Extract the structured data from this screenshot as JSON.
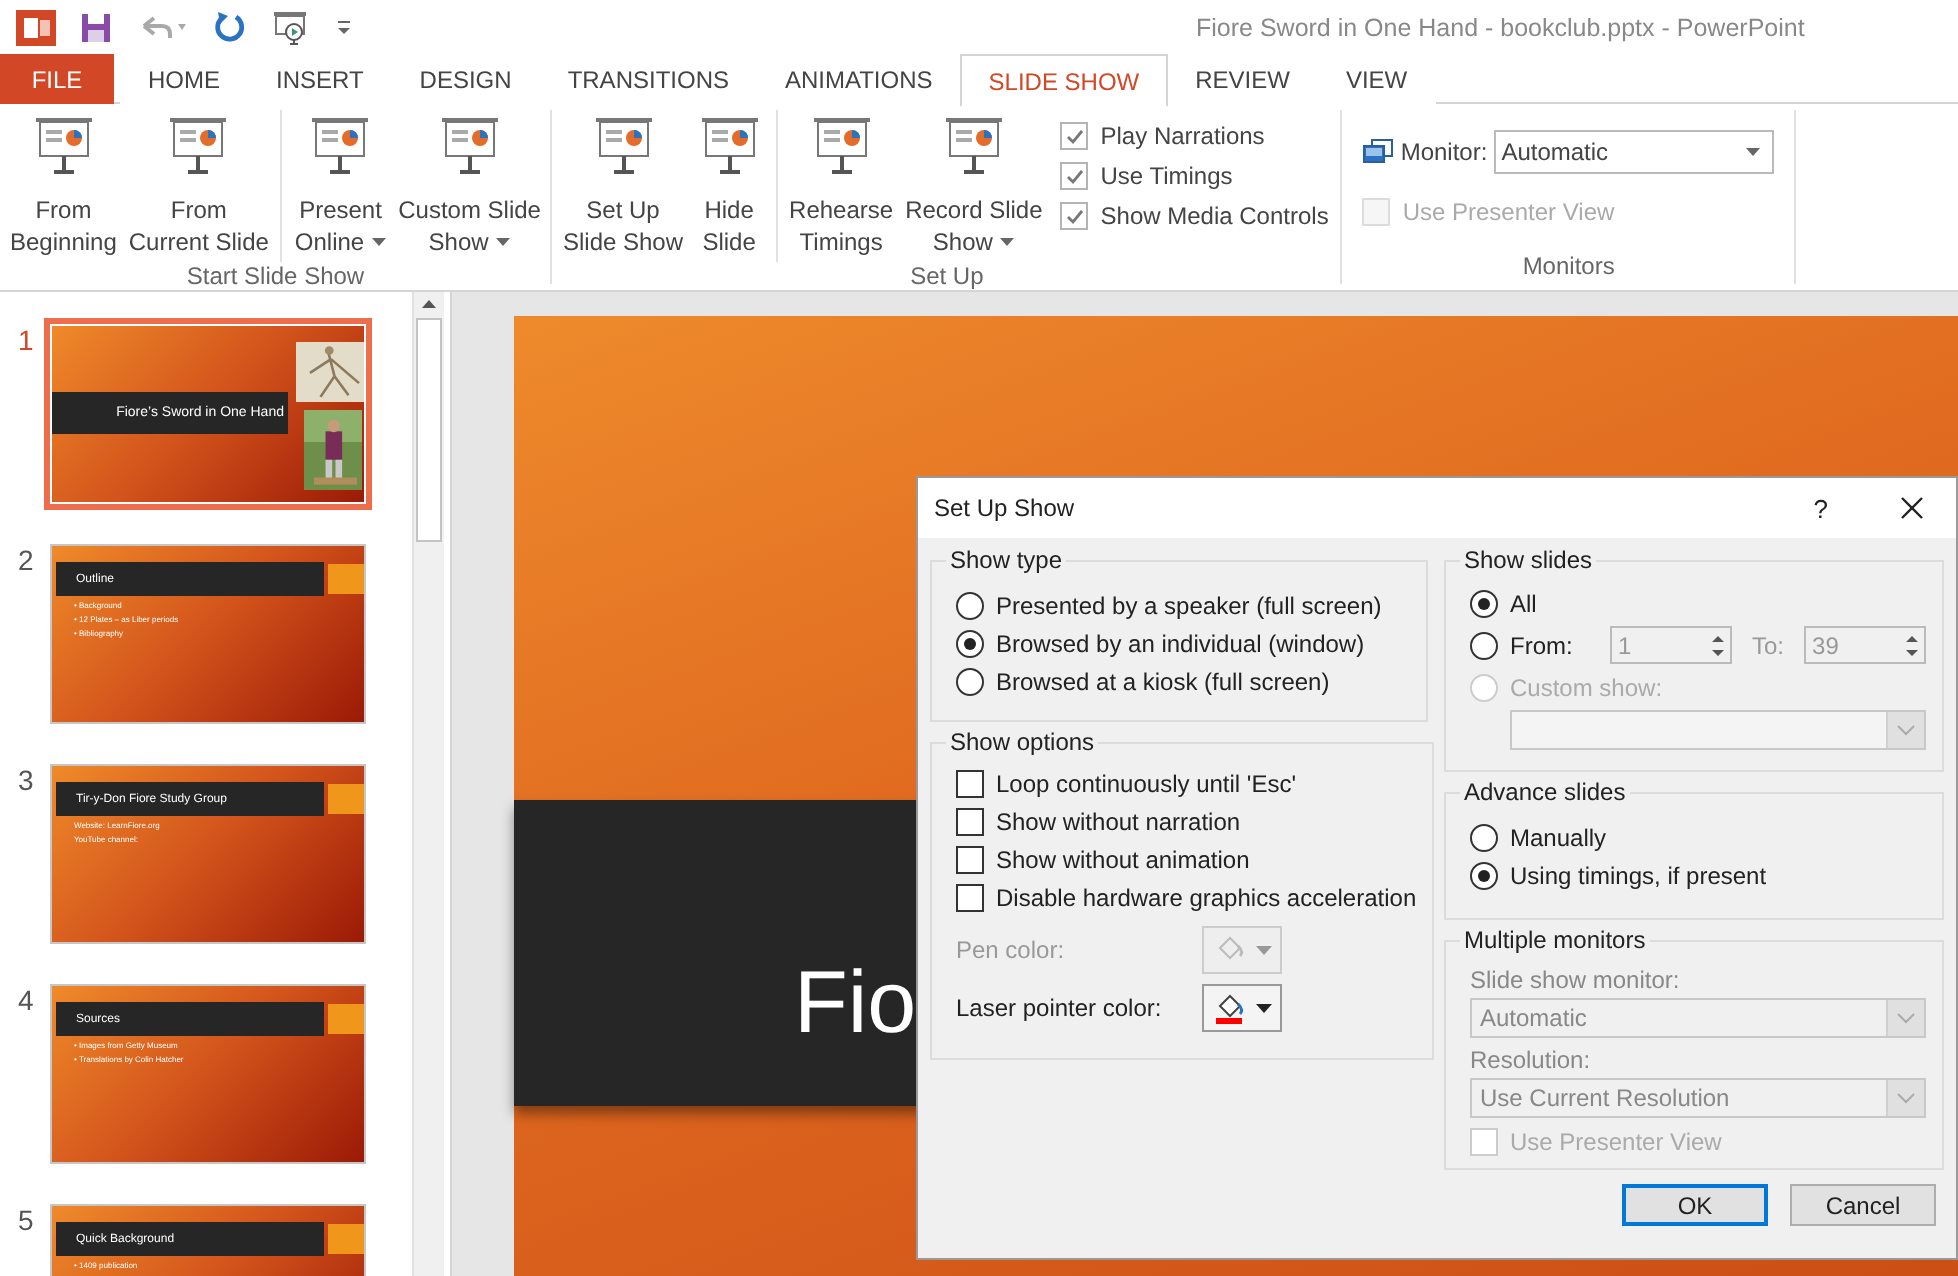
{
  "window": {
    "title": "Fiore Sword in One Hand - bookclub.pptx - PowerPoint"
  },
  "tabs": [
    {
      "label": "FILE",
      "kind": "file",
      "selected": false
    },
    {
      "label": "HOME",
      "kind": "tab",
      "selected": false
    },
    {
      "label": "INSERT",
      "kind": "tab",
      "selected": false
    },
    {
      "label": "DESIGN",
      "kind": "tab",
      "selected": false
    },
    {
      "label": "TRANSITIONS",
      "kind": "tab",
      "selected": false
    },
    {
      "label": "ANIMATIONS",
      "kind": "tab",
      "selected": false
    },
    {
      "label": "SLIDE SHOW",
      "kind": "tab",
      "selected": true
    },
    {
      "label": "REVIEW",
      "kind": "tab",
      "selected": false
    },
    {
      "label": "VIEW",
      "kind": "tab",
      "selected": false
    }
  ],
  "ribbon": [
    {
      "label": "Start Slide Show",
      "items": [
        {
          "kind": "button",
          "lines": [
            "From",
            "Beginning"
          ],
          "dropdown": false,
          "divider": false
        },
        {
          "kind": "button",
          "lines": [
            "From",
            "Current Slide"
          ],
          "dropdown": false,
          "divider": false
        },
        {
          "kind": "button",
          "lines": [
            "Present",
            "Online"
          ],
          "dropdown": true,
          "divider": true
        },
        {
          "kind": "button",
          "lines": [
            "Custom Slide",
            "Show"
          ],
          "dropdown": true,
          "divider": false
        }
      ]
    },
    {
      "label": "Set Up",
      "items": [
        {
          "kind": "button",
          "lines": [
            "Set Up",
            "Slide Show"
          ],
          "dropdown": false,
          "divider": false
        },
        {
          "kind": "button",
          "lines": [
            "Hide",
            "Slide"
          ],
          "dropdown": false,
          "divider": false
        },
        {
          "kind": "button",
          "lines": [
            "Rehearse",
            "Timings"
          ],
          "dropdown": false,
          "divider": true
        },
        {
          "kind": "button",
          "lines": [
            "Record Slide",
            "Show"
          ],
          "dropdown": true,
          "divider": false
        },
        {
          "kind": "checks",
          "checks": [
            {
              "label": "Play Narrations",
              "checked": true,
              "disabled": false
            },
            {
              "label": "Use Timings",
              "checked": true,
              "disabled": false
            },
            {
              "label": "Show Media Controls",
              "checked": true,
              "disabled": false
            }
          ]
        }
      ]
    },
    {
      "label": "Monitors",
      "items": [
        {
          "kind": "monitor",
          "label": "Monitor:",
          "value": "Automatic",
          "checks": [
            {
              "label": "Use Presenter View",
              "checked": false,
              "disabled": true
            }
          ]
        }
      ]
    }
  ],
  "slides": [
    {
      "number": "1",
      "selected": true,
      "kind": "title",
      "title": "Fiore’s Sword in One Hand"
    },
    {
      "number": "2",
      "selected": false,
      "kind": "content",
      "title": "Outline",
      "lines": [
        "• Background",
        "• 12 Plates – as Liber periods",
        "• Bibliography"
      ]
    },
    {
      "number": "3",
      "selected": false,
      "kind": "content",
      "title": "Tir-y-Don Fiore Study Group",
      "lines": [
        "Website: LearnFiore.org",
        "YouTube channel:"
      ]
    },
    {
      "number": "4",
      "selected": false,
      "kind": "content",
      "title": "Sources",
      "lines": [
        "• Images from Getty Museum",
        "• Translations by Colin Hatcher"
      ]
    },
    {
      "number": "5",
      "selected": false,
      "kind": "content",
      "title": "Quick Background",
      "lines": [
        "• 1409 publication"
      ]
    }
  ],
  "editor": {
    "slide_title": "Fio"
  },
  "dialog": {
    "title": "Set Up Show",
    "help": "?",
    "show_type": {
      "label": "Show type",
      "options": [
        {
          "label": "Presented by a speaker (full screen)",
          "selected": false
        },
        {
          "label": "Browsed by an individual (window)",
          "selected": true
        },
        {
          "label": "Browsed at a kiosk (full screen)",
          "selected": false
        }
      ]
    },
    "show_options": {
      "label": "Show options",
      "options": [
        {
          "label": "Loop continuously until 'Esc'",
          "checked": false
        },
        {
          "label": "Show without narration",
          "checked": false
        },
        {
          "label": "Show without animation",
          "checked": false
        },
        {
          "label": "Disable hardware graphics acceleration",
          "checked": false
        }
      ],
      "colors": [
        {
          "label": "Pen color:",
          "disabled": true
        },
        {
          "label": "Laser pointer color:",
          "disabled": false
        }
      ]
    },
    "show_slides": {
      "label": "Show slides",
      "options": [
        {
          "label": "All",
          "selected": true,
          "disabled": false
        },
        {
          "label": "From:",
          "selected": false,
          "disabled": false
        },
        {
          "label": "Custom show:",
          "selected": false,
          "disabled": true
        }
      ],
      "from": "1",
      "to_label": "To:",
      "to": "39"
    },
    "advance": {
      "label": "Advance slides",
      "options": [
        {
          "label": "Manually",
          "selected": false
        },
        {
          "label": "Using timings, if present",
          "selected": true
        }
      ]
    },
    "monitors": {
      "label": "Multiple monitors",
      "monitor_label": "Slide show monitor:",
      "monitor": "Automatic",
      "resolution_label": "Resolution:",
      "resolution": "Use Current Resolution",
      "presenter": {
        "label": "Use Presenter View",
        "checked": false
      }
    },
    "buttons": [
      {
        "label": "OK",
        "default": true
      },
      {
        "label": "Cancel",
        "default": false
      }
    ]
  }
}
